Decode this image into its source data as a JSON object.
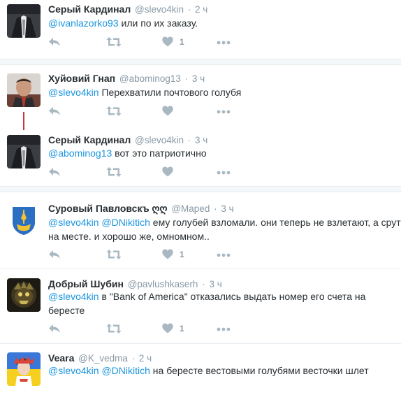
{
  "tweets": [
    {
      "name": "Серый Кардинал",
      "handle": "@slevo4kin",
      "time": "2 ч",
      "mention1": "@ivanlazorko93",
      "text1": " или по их заказу.",
      "likes": "1"
    },
    {
      "name": "Хуйовий Гнап",
      "handle": "@abominog13",
      "time": "3 ч",
      "mention1": "@slevo4kin",
      "text1": " Перехватили почтового голубя"
    },
    {
      "name": "Серый Кардинал",
      "handle": "@slevo4kin",
      "time": "3 ч",
      "mention1": "@abominog13",
      "text1": " вот это патриотично"
    },
    {
      "name": "Суровый Павловскъ ღღ",
      "handle": "@Maped",
      "time": "3 ч",
      "mention1": "@slevo4kin",
      "mention2": "@DNikitich",
      "text1": " ему голубей взломали. они теперь не взлетают, а срут",
      "text2": "на месте. и хорошо же, омномном..",
      "likes": "1"
    },
    {
      "name": "Добрый Шубин",
      "handle": "@pavlushkaserh",
      "time": "3 ч",
      "mention1": "@slevo4kin",
      "text1": " в \"Bank of America\" отказались выдать номер его счета на",
      "text2": "бересте",
      "likes": "1"
    },
    {
      "name": "Veara",
      "handle": "@K_vedma",
      "time": "2 ч",
      "mention1": "@slevo4kin",
      "mention2": "@DNikitich",
      "text1": " на бересте вестовыми голубями весточки шлет"
    }
  ],
  "colors": {
    "mention": "#1b95e0",
    "meta": "#8899a6",
    "icon": "#aab8c2",
    "thread": "#c23a3a"
  },
  "icons": [
    "reply-icon",
    "retweet-icon",
    "heart-icon",
    "more-icon"
  ]
}
